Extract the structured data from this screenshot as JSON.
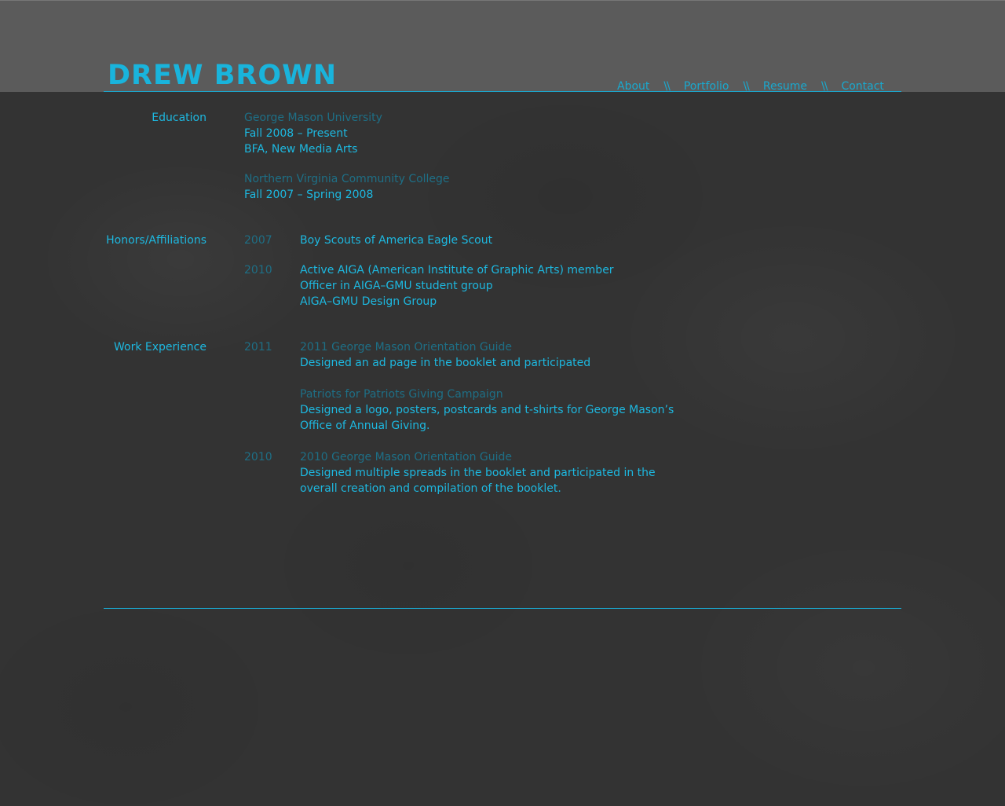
{
  "header": {
    "title": "DREW BROWN",
    "nav": [
      {
        "label": "About"
      },
      {
        "label": "Portfolio"
      },
      {
        "label": "Resume"
      },
      {
        "label": "Contact"
      }
    ],
    "separator": "\\\\"
  },
  "colors": {
    "accent": "#1db8e0",
    "accent_dim": "#1e6f86",
    "header_band": "#5b5b5b",
    "background": "#333333"
  },
  "education": {
    "label": "Education",
    "entries": [
      {
        "school": "George Mason University",
        "dates": "Fall 2008 – Present",
        "degree": "BFA, New Media Arts"
      },
      {
        "school": "Northern Virginia Community College",
        "dates": "Fall 2007 – Spring 2008"
      }
    ]
  },
  "honors": {
    "label": "Honors/Affiliations",
    "entries": [
      {
        "year": "2007",
        "lines": [
          "Boy Scouts of America Eagle Scout"
        ]
      },
      {
        "year": "2010",
        "lines": [
          "Active AIGA (American Institute of Graphic Arts) member",
          "Officer in AIGA–GMU student group",
          "AIGA–GMU Design Group"
        ]
      }
    ]
  },
  "work": {
    "label": "Work Experience",
    "entries": [
      {
        "year": "2011",
        "title": "2011 George Mason Orientation Guide",
        "lines": [
          "Designed an ad page in the booklet and participated"
        ]
      },
      {
        "title": "Patriots for Patriots Giving Campaign",
        "lines": [
          "Designed a logo, posters, postcards and t-shirts for George Mason’s",
          "Office of Annual Giving."
        ]
      },
      {
        "year": "2010",
        "title": "2010 George Mason Orientation Guide",
        "lines": [
          "Designed multiple spreads in the booklet and participated in the",
          "overall creation and compilation of the booklet."
        ]
      }
    ]
  }
}
